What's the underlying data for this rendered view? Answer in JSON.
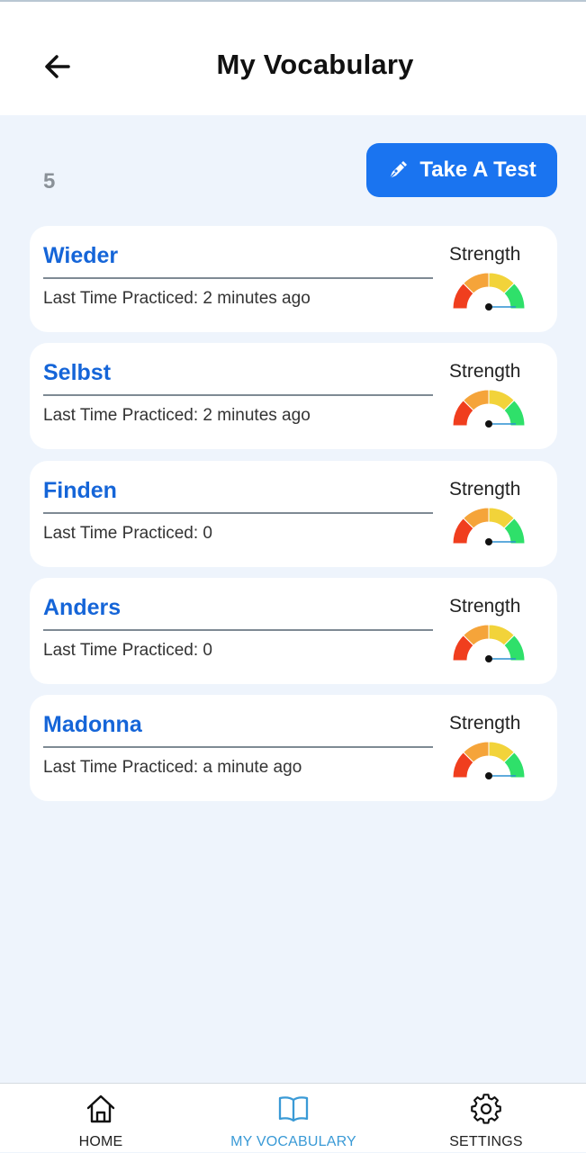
{
  "header": {
    "title": "My Vocabulary"
  },
  "toolbar": {
    "count": "5",
    "test_label": "Take A Test"
  },
  "strength_label": "Strength",
  "words": [
    {
      "word": "Wieder",
      "practiced": "Last Time Practiced: 2 minutes ago"
    },
    {
      "word": "Selbst",
      "practiced": "Last Time Practiced: 2 minutes ago"
    },
    {
      "word": "Finden",
      "practiced": "Last Time Practiced: 0"
    },
    {
      "word": "Anders",
      "practiced": "Last Time Practiced: 0"
    },
    {
      "word": "Madonna",
      "practiced": "Last Time Practiced: a minute ago"
    }
  ],
  "nav": {
    "items": [
      {
        "label": "HOME",
        "icon": "home-icon",
        "active": false
      },
      {
        "label": "MY VOCABULARY",
        "icon": "book-icon",
        "active": true
      },
      {
        "label": "SETTINGS",
        "icon": "gear-icon",
        "active": false
      }
    ]
  },
  "colors": {
    "accent": "#1a74f0",
    "word": "#1565d8",
    "nav_active": "#3a9ad6",
    "gauge": [
      "#f03e1e",
      "#f5a43a",
      "#f2d33a",
      "#2fe06a"
    ]
  }
}
